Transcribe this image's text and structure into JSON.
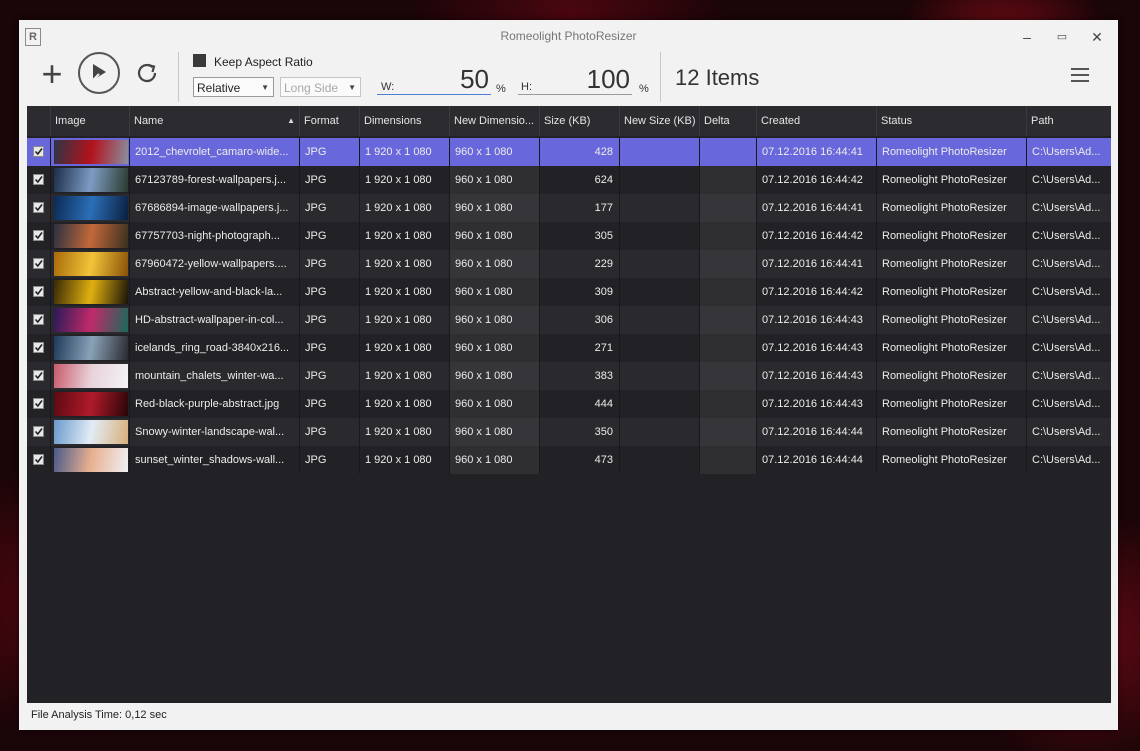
{
  "window": {
    "title": "Romeolight PhotoResizer",
    "logo": "R",
    "minimize": "–",
    "maximize": "▭",
    "close": "✕"
  },
  "toolbar": {
    "add_icon": "+",
    "keep_aspect_ratio": "Keep Aspect Ratio",
    "mode_select": "Relative",
    "side_select": "Long Side",
    "width_label": "W:",
    "width_value": "50",
    "width_unit": "%",
    "height_label": "H:",
    "height_value": "100",
    "height_unit": "%",
    "items_count": "12 Items"
  },
  "table": {
    "columns": [
      "Image",
      "Name",
      "Format",
      "Dimensions",
      "New Dimensio...",
      "Size (KB)",
      "New Size (KB)",
      "Delta",
      "Created",
      "Status",
      "Path"
    ],
    "rows": [
      {
        "name": "2012_chevrolet_camaro-wide...",
        "format": "JPG",
        "dims": "1 920 x 1 080",
        "new_dims": "960 x 1 080",
        "size": "428",
        "new_size": "",
        "delta": "",
        "created": "07.12.2016 16:44:41",
        "status": "Romeolight PhotoResizer",
        "path": "C:\\Users\\Ad...",
        "thumb": [
          "#2c3548",
          "#b3121b",
          "#8a8fa0"
        ]
      },
      {
        "name": "67123789-forest-wallpapers.j...",
        "format": "JPG",
        "dims": "1 920 x 1 080",
        "new_dims": "960 x 1 080",
        "size": "624",
        "new_size": "",
        "delta": "",
        "created": "07.12.2016 16:44:42",
        "status": "Romeolight PhotoResizer",
        "path": "C:\\Users\\Ad...",
        "thumb": [
          "#1c2e4a",
          "#7d9cc4",
          "#2a3a2c"
        ]
      },
      {
        "name": "67686894-image-wallpapers.j...",
        "format": "JPG",
        "dims": "1 920 x 1 080",
        "new_dims": "960 x 1 080",
        "size": "177",
        "new_size": "",
        "delta": "",
        "created": "07.12.2016 16:44:41",
        "status": "Romeolight PhotoResizer",
        "path": "C:\\Users\\Ad...",
        "thumb": [
          "#0b2a55",
          "#2b6fb8",
          "#0a1f3e"
        ]
      },
      {
        "name": "67757703-night-photograph...",
        "format": "JPG",
        "dims": "1 920 x 1 080",
        "new_dims": "960 x 1 080",
        "size": "305",
        "new_size": "",
        "delta": "",
        "created": "07.12.2016 16:44:42",
        "status": "Romeolight PhotoResizer",
        "path": "C:\\Users\\Ad...",
        "thumb": [
          "#2a3140",
          "#c2683a",
          "#3a3020"
        ]
      },
      {
        "name": "67960472-yellow-wallpapers....",
        "format": "JPG",
        "dims": "1 920 x 1 080",
        "new_dims": "960 x 1 080",
        "size": "229",
        "new_size": "",
        "delta": "",
        "created": "07.12.2016 16:44:41",
        "status": "Romeolight PhotoResizer",
        "path": "C:\\Users\\Ad...",
        "thumb": [
          "#a86a0a",
          "#f2c438",
          "#8a5208"
        ]
      },
      {
        "name": "Abstract-yellow-and-black-la...",
        "format": "JPG",
        "dims": "1 920 x 1 080",
        "new_dims": "960 x 1 080",
        "size": "309",
        "new_size": "",
        "delta": "",
        "created": "07.12.2016 16:44:42",
        "status": "Romeolight PhotoResizer",
        "path": "C:\\Users\\Ad...",
        "thumb": [
          "#3a2a05",
          "#e0b010",
          "#1a1408"
        ]
      },
      {
        "name": "HD-abstract-wallpaper-in-col...",
        "format": "JPG",
        "dims": "1 920 x 1 080",
        "new_dims": "960 x 1 080",
        "size": "306",
        "new_size": "",
        "delta": "",
        "created": "07.12.2016 16:44:43",
        "status": "Romeolight PhotoResizer",
        "path": "C:\\Users\\Ad...",
        "thumb": [
          "#2a1a58",
          "#c02a6a",
          "#1a6a5a"
        ]
      },
      {
        "name": "icelands_ring_road-3840x216...",
        "format": "JPG",
        "dims": "1 920 x 1 080",
        "new_dims": "960 x 1 080",
        "size": "271",
        "new_size": "",
        "delta": "",
        "created": "07.12.2016 16:44:43",
        "status": "Romeolight PhotoResizer",
        "path": "C:\\Users\\Ad...",
        "thumb": [
          "#1e3a5a",
          "#8aa2b8",
          "#2a2a30"
        ]
      },
      {
        "name": "mountain_chalets_winter-wa...",
        "format": "JPG",
        "dims": "1 920 x 1 080",
        "new_dims": "960 x 1 080",
        "size": "383",
        "new_size": "",
        "delta": "",
        "created": "07.12.2016 16:44:43",
        "status": "Romeolight PhotoResizer",
        "path": "C:\\Users\\Ad...",
        "thumb": [
          "#c85a6a",
          "#e8d2da",
          "#f2f2f6"
        ]
      },
      {
        "name": "Red-black-purple-abstract.jpg",
        "format": "JPG",
        "dims": "1 920 x 1 080",
        "new_dims": "960 x 1 080",
        "size": "444",
        "new_size": "",
        "delta": "",
        "created": "07.12.2016 16:44:43",
        "status": "Romeolight PhotoResizer",
        "path": "C:\\Users\\Ad...",
        "thumb": [
          "#5a0a12",
          "#b01a2a",
          "#2a0508"
        ]
      },
      {
        "name": "Snowy-winter-landscape-wal...",
        "format": "JPG",
        "dims": "1 920 x 1 080",
        "new_dims": "960 x 1 080",
        "size": "350",
        "new_size": "",
        "delta": "",
        "created": "07.12.2016 16:44:44",
        "status": "Romeolight PhotoResizer",
        "path": "C:\\Users\\Ad...",
        "thumb": [
          "#6a9acc",
          "#e2ecf6",
          "#d8b07a"
        ]
      },
      {
        "name": "sunset_winter_shadows-wall...",
        "format": "JPG",
        "dims": "1 920 x 1 080",
        "new_dims": "960 x 1 080",
        "size": "473",
        "new_size": "",
        "delta": "",
        "created": "07.12.2016 16:44:44",
        "status": "Romeolight PhotoResizer",
        "path": "C:\\Users\\Ad...",
        "thumb": [
          "#4a5a8a",
          "#e8b090",
          "#f0f0f4"
        ]
      }
    ]
  },
  "status_bar": {
    "text": "File Analysis Time: 0,12 sec"
  },
  "colors": {
    "selected_row": "#6868dc",
    "grid_bg": "#222226",
    "row_even": "#2a2a2e",
    "row_odd": "#222226",
    "accent_line": "#4a7fd4"
  }
}
